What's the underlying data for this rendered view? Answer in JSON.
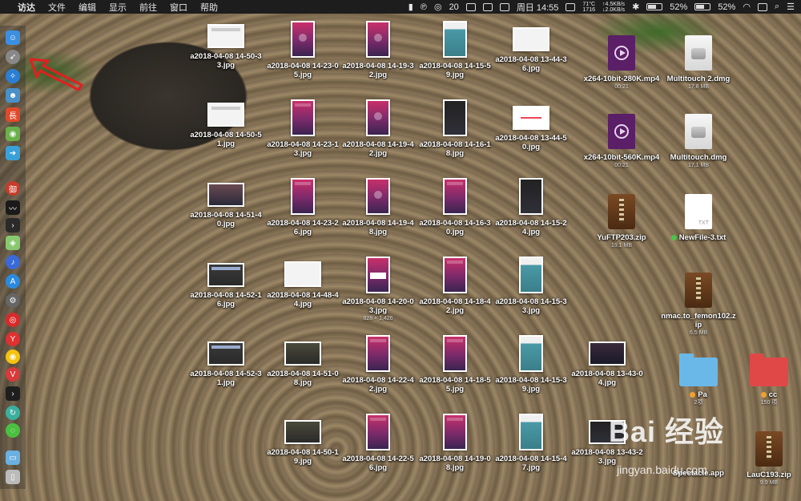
{
  "menubar": {
    "app_name": "访达",
    "menus": [
      "文件",
      "编辑",
      "显示",
      "前往",
      "窗口",
      "帮助"
    ],
    "wechat_count": "20",
    "temp_line1": "71°C",
    "temp_line2": "1716",
    "net_up": "↑4.5KB/s",
    "net_down": "↓2.0KB/s",
    "battery_percent_1": "52%",
    "battery_percent_2": "52%",
    "clock": "周日 14:55"
  },
  "dock": {
    "icons": [
      "finder-icon",
      "launchpad-icon",
      "safari-icon",
      "contacts-icon",
      "app-red-icon",
      "android-icon",
      "migration-icon",
      "chinese-app-icon",
      "activity-monitor-icon",
      "terminal-icon",
      "maps-icon",
      "siri-icon",
      "app-store-icon",
      "system-preferences-icon",
      "netease-music-icon",
      "yandex-icon",
      "chrome-icon",
      "vivaldi-icon",
      "terminal2-icon",
      "wechat-icon",
      "downloads-folder-icon",
      "trash-icon"
    ]
  },
  "files": [
    {
      "name": "a2018-04-08 14-50-33.jpg",
      "sub": ""
    },
    {
      "name": "a2018-04-08 14-23-05.jpg",
      "sub": ""
    },
    {
      "name": "a2018-04-08 14-19-32.jpg",
      "sub": ""
    },
    {
      "name": "a2018-04-08 14-15-59.jpg",
      "sub": ""
    },
    {
      "name": "a2018-04-08 13-44-36.jpg",
      "sub": ""
    },
    {
      "name": "a2018-04-08 14-50-51.jpg",
      "sub": ""
    },
    {
      "name": "a2018-04-08 14-23-13.jpg",
      "sub": ""
    },
    {
      "name": "a2018-04-08 14-19-42.jpg",
      "sub": ""
    },
    {
      "name": "a2018-04-08 14-16-18.jpg",
      "sub": ""
    },
    {
      "name": "a2018-04-08 13-44-50.jpg",
      "sub": ""
    },
    {
      "name": "a2018-04-08 14-51-40.jpg",
      "sub": ""
    },
    {
      "name": "a2018-04-08 14-23-26.jpg",
      "sub": ""
    },
    {
      "name": "a2018-04-08 14-19-48.jpg",
      "sub": ""
    },
    {
      "name": "a2018-04-08 14-16-30.jpg",
      "sub": ""
    },
    {
      "name": "a2018-04-08 14-15-24.jpg",
      "sub": ""
    },
    {
      "name": "a2018-04-08 14-52-16.jpg",
      "sub": ""
    },
    {
      "name": "a2018-04-08 14-48-44.jpg",
      "sub": ""
    },
    {
      "name": "a2018-04-08 14-20-03.jpg",
      "sub": "828 × 1,426"
    },
    {
      "name": "a2018-04-08 14-18-42.jpg",
      "sub": ""
    },
    {
      "name": "a2018-04-08 14-15-33.jpg",
      "sub": ""
    },
    {
      "name": "a2018-04-08 14-52-31.jpg",
      "sub": ""
    },
    {
      "name": "a2018-04-08 14-51-08.jpg",
      "sub": ""
    },
    {
      "name": "a2018-04-08 14-22-42.jpg",
      "sub": ""
    },
    {
      "name": "a2018-04-08 14-18-55.jpg",
      "sub": ""
    },
    {
      "name": "a2018-04-08 14-15-39.jpg",
      "sub": ""
    },
    {
      "name": "a2018-04-08 13-43-04.jpg",
      "sub": ""
    },
    {
      "name": "a2018-04-08 14-50-19.jpg",
      "sub": ""
    },
    {
      "name": "a2018-04-08 14-22-56.jpg",
      "sub": ""
    },
    {
      "name": "a2018-04-08 14-19-08.jpg",
      "sub": ""
    },
    {
      "name": "a2018-04-08 14-15-47.jpg",
      "sub": ""
    },
    {
      "name": "a2018-04-08 13-43-23.jpg",
      "sub": ""
    }
  ],
  "right_items": [
    {
      "name": "x264-10bit-280K.mp4",
      "sub": "00:21"
    },
    {
      "name": "Multitouch 2.dmg",
      "sub": "17.8 MB"
    },
    {
      "name": "x264-10bit-560K.mp4",
      "sub": "00:21"
    },
    {
      "name": "Multitouch.dmg",
      "sub": "17.1 MB"
    },
    {
      "name": "YuFTP203.zip",
      "sub": "19.1 MB"
    },
    {
      "name": "NewFile-3.txt",
      "sub": ""
    },
    {
      "name": "nmac.to_femon102.zip",
      "sub": "6.5 MB"
    },
    {
      "name": "Pa",
      "sub": "2项"
    },
    {
      "name": "cc",
      "sub": "150 项"
    },
    {
      "name": "Spectacle.app",
      "sub": ""
    },
    {
      "name": "LauC193.zip",
      "sub": "9.9 MB"
    }
  ],
  "txt_label": "TXT",
  "watermark": {
    "brand": "Bai  经验",
    "url": "jingyan.baidu.com"
  }
}
